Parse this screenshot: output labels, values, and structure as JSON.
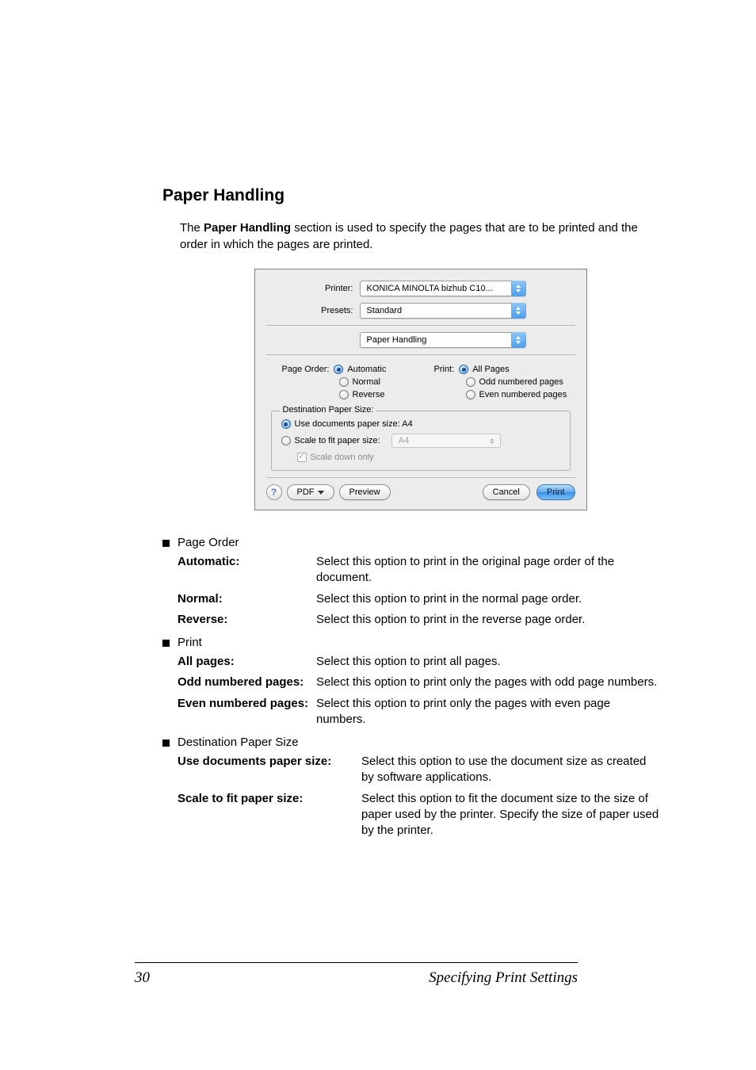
{
  "section_title": "Paper Handling",
  "intro_before": "The ",
  "intro_bold": "Paper Handling",
  "intro_after": " section is used to specify the pages that are to be printed and the order in which the pages are printed.",
  "dialog": {
    "printer_label": "Printer:",
    "printer_value": "KONICA MINOLTA bizhub C10...",
    "presets_label": "Presets:",
    "presets_value": "Standard",
    "section_value": "Paper Handling",
    "page_order_label": "Page Order:",
    "page_order": {
      "automatic": "Automatic",
      "normal": "Normal",
      "reverse": "Reverse"
    },
    "print_label": "Print:",
    "print": {
      "all": "All Pages",
      "odd": "Odd numbered pages",
      "even": "Even numbered pages"
    },
    "dest_title": "Destination Paper Size:",
    "use_doc": "Use documents paper size:  A4",
    "scale_fit": "Scale to fit paper size:",
    "scale_value": "A4",
    "scale_down": "Scale down only",
    "help": "?",
    "pdf_btn": "PDF",
    "preview_btn": "Preview",
    "cancel_btn": "Cancel",
    "print_btn": "Print"
  },
  "lists": {
    "page_order_heading": "Page Order",
    "print_heading": "Print",
    "dest_heading": "Destination Paper Size",
    "page_order": {
      "automatic_term": "Automatic",
      "automatic_def": "Select this option to print in the original page order of the document.",
      "normal_term": "Normal",
      "normal_def": "Select this option to print in the normal page order.",
      "reverse_term": "Reverse",
      "reverse_def": "Select this option to print in the reverse page order."
    },
    "print": {
      "all_term": "All pages",
      "all_def": "Select this option to print all pages.",
      "odd_term": "Odd numbered pages",
      "odd_def": "Select this option to print only the pages with odd page numbers.",
      "even_term": "Even numbered pages",
      "even_def": "Select this option to print only the pages with even page numbers."
    },
    "dest": {
      "use_term": "Use documents paper size",
      "use_def": "Select this option to use the document size as created by software applications.",
      "scale_term": "Scale to fit paper size",
      "scale_def": "Select this option to fit the document size to the size of paper used by the printer. Specify the size of paper used by the printer."
    }
  },
  "footer": {
    "page": "30",
    "title": "Specifying Print Settings"
  },
  "colon": ":"
}
